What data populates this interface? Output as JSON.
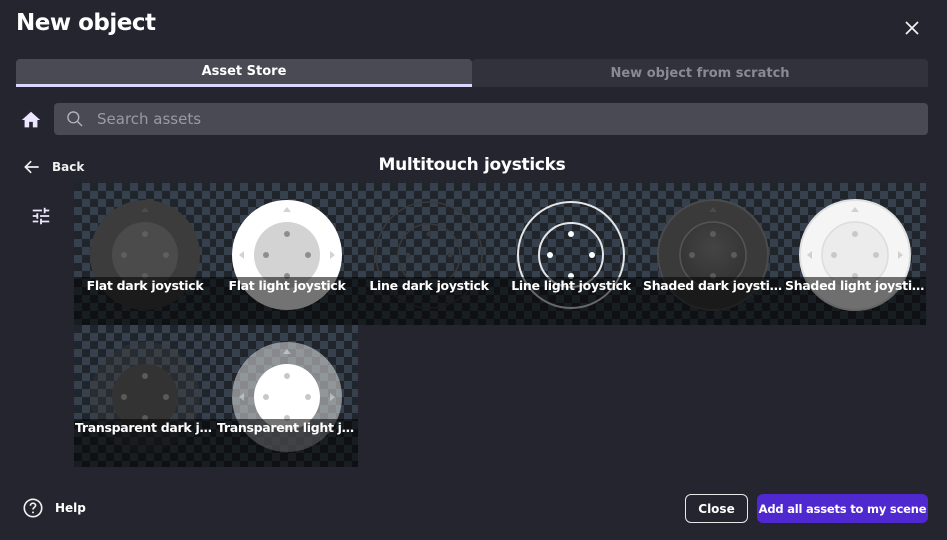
{
  "dialog": {
    "title": "New object",
    "close_icon": "close-icon"
  },
  "tabs": [
    {
      "label": "Asset Store",
      "active": true
    },
    {
      "label": "New object from scratch",
      "active": false
    }
  ],
  "search": {
    "placeholder": "Search assets",
    "value": "",
    "home_icon": "home-icon",
    "search_icon": "search-icon"
  },
  "navigation": {
    "back_label": "Back",
    "pack_title": "Multitouch joysticks",
    "filter_icon": "filter-sliders-icon"
  },
  "assets": [
    {
      "name": "Flat dark joystick",
      "style": "flat-dark"
    },
    {
      "name": "Flat light joystick",
      "style": "flat-light"
    },
    {
      "name": "Line dark joystick",
      "style": "line-dark"
    },
    {
      "name": "Line light joystick",
      "style": "line-light"
    },
    {
      "name": "Shaded dark joystick",
      "style": "shaded-dark"
    },
    {
      "name": "Shaded light joystick",
      "style": "shaded-light"
    },
    {
      "name": "Transparent dark jo...",
      "style": "transparent-dark"
    },
    {
      "name": "Transparent light jo...",
      "style": "transparent-light"
    }
  ],
  "footer": {
    "help_label": "Help",
    "close_label": "Close",
    "add_all_label": "Add all assets to my scene"
  },
  "colors": {
    "primary_button": "#4f28d0",
    "tab_indicator": "#ddd6ff",
    "background": "#25252f"
  }
}
